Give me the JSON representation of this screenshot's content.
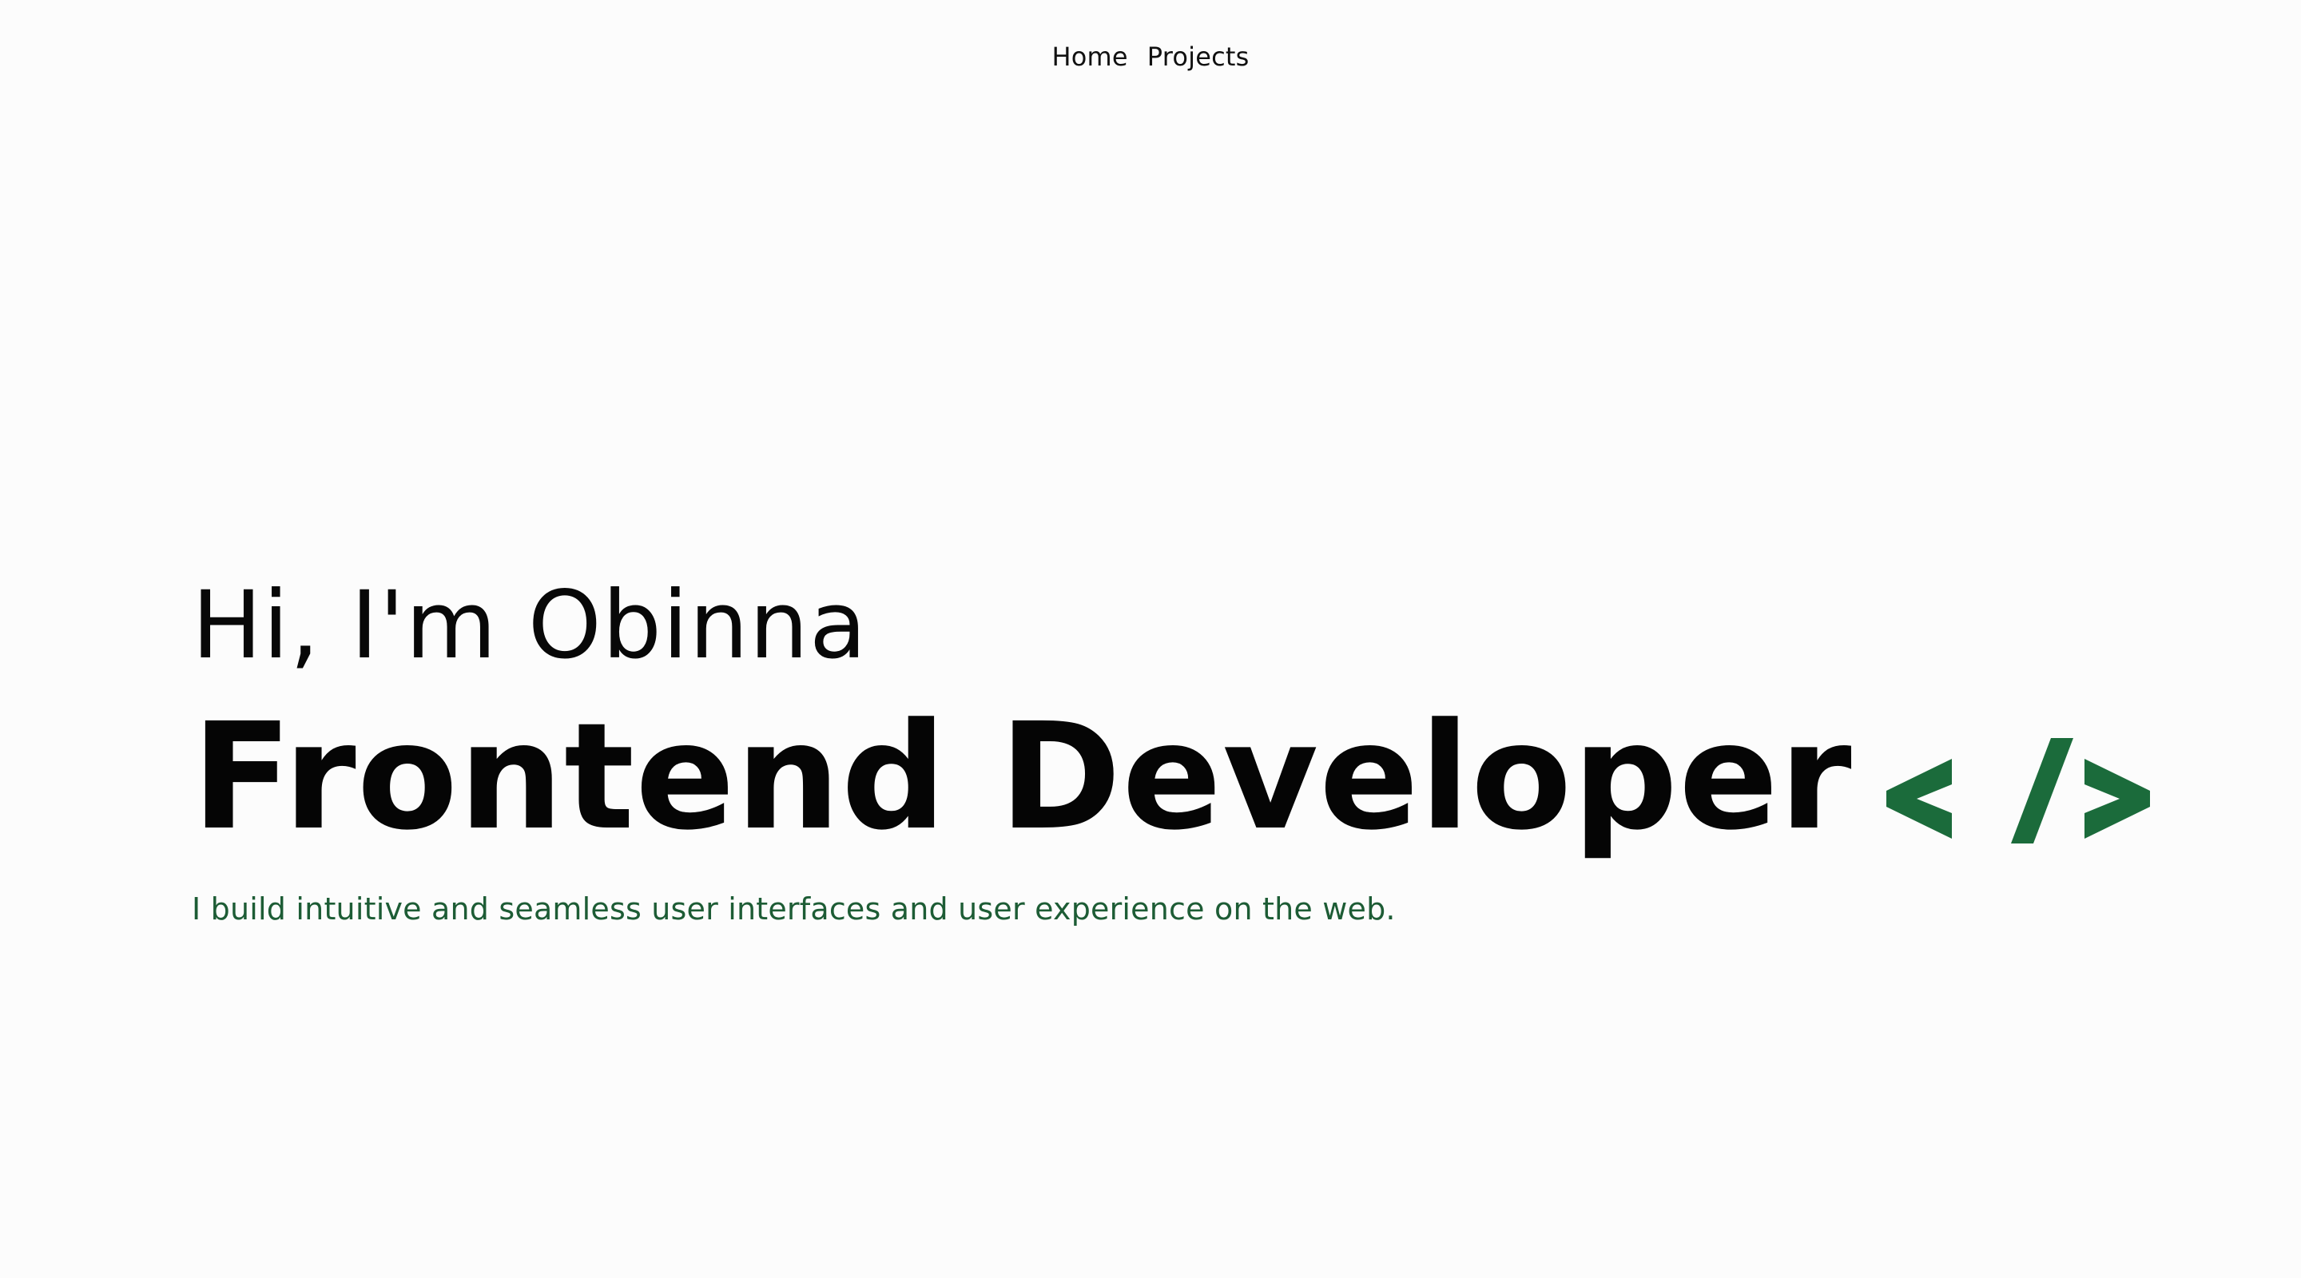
{
  "nav": {
    "items": [
      {
        "label": "Home"
      },
      {
        "label": "Projects"
      }
    ]
  },
  "hero": {
    "greeting": "Hi, I'm Obinna",
    "title": "Frontend Developer",
    "title_icon": "code-brackets-icon",
    "tagline": "I build intuitive and seamless user interfaces and user experience on the web."
  },
  "colors": {
    "accent": "#1b6b3b",
    "tagline": "#1d5c35",
    "text": "#080808",
    "background": "#fcfcfc"
  }
}
